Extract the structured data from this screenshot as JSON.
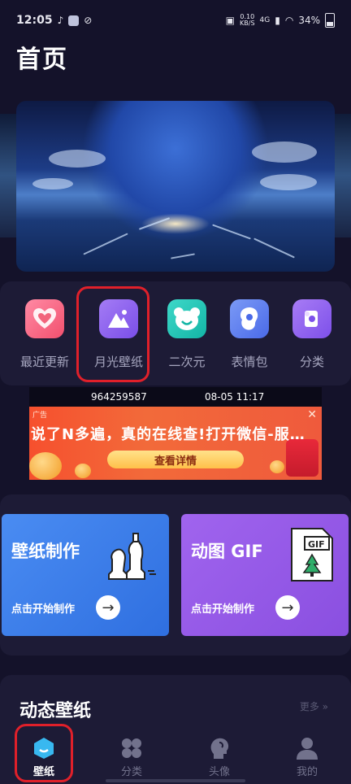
{
  "status_bar": {
    "time": "12:05",
    "net_speed_value": "0.10",
    "net_speed_unit": "KB/S",
    "network": "4G",
    "battery": "34%"
  },
  "page": {
    "title": "首页"
  },
  "categories": [
    {
      "label": "最近更新",
      "icon": "heart-icon",
      "color": "#f2647c"
    },
    {
      "label": "月光壁纸",
      "icon": "mountain-image-icon",
      "color": "#8b5cf0"
    },
    {
      "label": "二次元",
      "icon": "bear-face-icon",
      "color": "#1ec6b6"
    },
    {
      "label": "表情包",
      "icon": "sticker-face-icon",
      "color": "#5a7cf0"
    },
    {
      "label": "分类",
      "icon": "category-icon",
      "color": "#8a5ef0"
    }
  ],
  "ad": {
    "id_text": "964259587",
    "time_text": "08-05 11:17",
    "tag": "广告",
    "text": "说了N多遍，真的在线查!打开微信-服…",
    "button": "查看详情",
    "close": "✕"
  },
  "tools": [
    {
      "title": "壁纸制作",
      "subtitle": "点击开始制作",
      "arrow": "→",
      "icon": "chess-knight-icon",
      "color": "#3d7eea"
    },
    {
      "title": "动图 GIF",
      "subtitle": "点击开始制作",
      "arrow": "→",
      "icon": "gif-file-icon",
      "color": "#9a5cec"
    }
  ],
  "live_section": {
    "title": "动态壁纸",
    "more": "更多 »"
  },
  "bottom_nav": [
    {
      "label": "壁纸",
      "icon": "wallpaper-icon",
      "active": true
    },
    {
      "label": "分类",
      "icon": "grid-icon",
      "active": false
    },
    {
      "label": "头像",
      "icon": "avatar-head-icon",
      "active": false
    },
    {
      "label": "我的",
      "icon": "user-icon",
      "active": false
    }
  ],
  "colors": {
    "background": "#14122a",
    "panel": "#1d1b36",
    "highlight": "#e0202a"
  }
}
